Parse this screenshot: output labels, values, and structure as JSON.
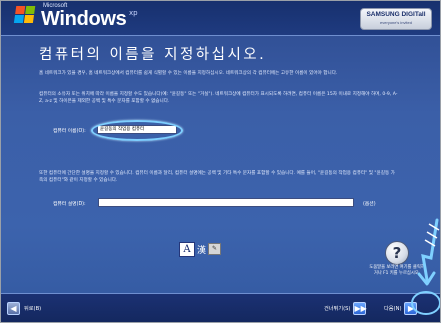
{
  "header": {
    "ms_label": "Microsoft",
    "windows_label": "Windows",
    "xp_label": "xp",
    "brand_name": "SAMSUNG DIGITall",
    "brand_tagline": "everyone's invited"
  },
  "main": {
    "title": "컴퓨터의 이름을 지정하십시오.",
    "para1": "홈 네트워크가 있을 경우, 홈 네트워크상에서 컴퓨터를 쉽게 식별할 수 있는 이름을 지정하십시오. 네트워크상의 각 컴퓨터에는 고유한 이름이 있어야 합니다.",
    "para2": "컴퓨터의 소유자 또는 위치에 따라 이름을 지정할 수도 있습니다(예: \"윤길동\" 또는 \"거실\"). 네트워크상에 컴퓨터가 표시되도록 하려면, 컴퓨터 이름은 15자 이내로 지정해야 하며, 0-9, A-Z, a-z 및 하이픈을 제외한 공백 및 특수 문자를 포함할 수 없습니다.",
    "name_label": "컴퓨터 이름(O):",
    "name_value": "윤길동의 작업용 컴퓨터",
    "para3": "또한 컴퓨터에 간단한 설명을 지정할 수 있습니다. 컴퓨터 이름과 달리, 컴퓨터 설명에는 공백 및 기타 특수 문자를 포함할 수 있습니다. 예를 들어, \"윤길동의 작업용 컴퓨터\" 및 \"윤길동 가족의 컴퓨터\"와 같이 지정할 수 있습니다.",
    "desc_label": "컴퓨터 설명(D):",
    "desc_value": "",
    "desc_optional": "(옵션)"
  },
  "ime": {
    "lang_glyph": "A",
    "mode_glyph": "漢",
    "pad_glyph": "✎"
  },
  "help": {
    "icon_glyph": "?",
    "text": "도움말을 보려면 여기를 클릭하거나 F1 키를 누르십시오."
  },
  "footer": {
    "back_label": "뒤로(B)",
    "skip_label": "건너뛰기(S)",
    "next_label": "다음(N)"
  },
  "colors": {
    "background": "#3b5fa8",
    "bar": "#17306e",
    "highlight": "#7fd0ff",
    "accent_button": "#2d67d8"
  }
}
